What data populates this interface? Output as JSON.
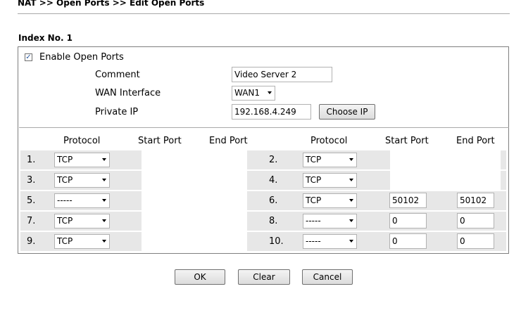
{
  "breadcrumb": "NAT >> Open Ports >> Edit Open Ports",
  "index_label": "Index No. 1",
  "enable": {
    "label": "Enable Open Ports",
    "checked": true
  },
  "comment": {
    "label": "Comment",
    "value": "Video Server 2"
  },
  "wan": {
    "label": "WAN Interface",
    "value": "WAN1"
  },
  "private_ip": {
    "label": "Private IP",
    "value": "192.168.4.249",
    "button": "Choose IP"
  },
  "headers": {
    "protocol": "Protocol",
    "start": "Start Port",
    "end": "End Port"
  },
  "left_rows": [
    {
      "num": "1.",
      "protocol": "TCP"
    },
    {
      "num": "3.",
      "protocol": "TCP"
    },
    {
      "num": "5.",
      "protocol": "-----"
    },
    {
      "num": "7.",
      "protocol": "TCP"
    },
    {
      "num": "9.",
      "protocol": "TCP"
    }
  ],
  "right_rows": [
    {
      "num": "2.",
      "protocol": "TCP",
      "start": "",
      "end": ""
    },
    {
      "num": "4.",
      "protocol": "TCP",
      "start": "",
      "end": ""
    },
    {
      "num": "6.",
      "protocol": "TCP",
      "start": "50102",
      "end": "50102"
    },
    {
      "num": "8.",
      "protocol": "-----",
      "start": "0",
      "end": "0"
    },
    {
      "num": "10.",
      "protocol": "-----",
      "start": "0",
      "end": "0"
    }
  ],
  "buttons": {
    "ok": "OK",
    "clear": "Clear",
    "cancel": "Cancel"
  }
}
